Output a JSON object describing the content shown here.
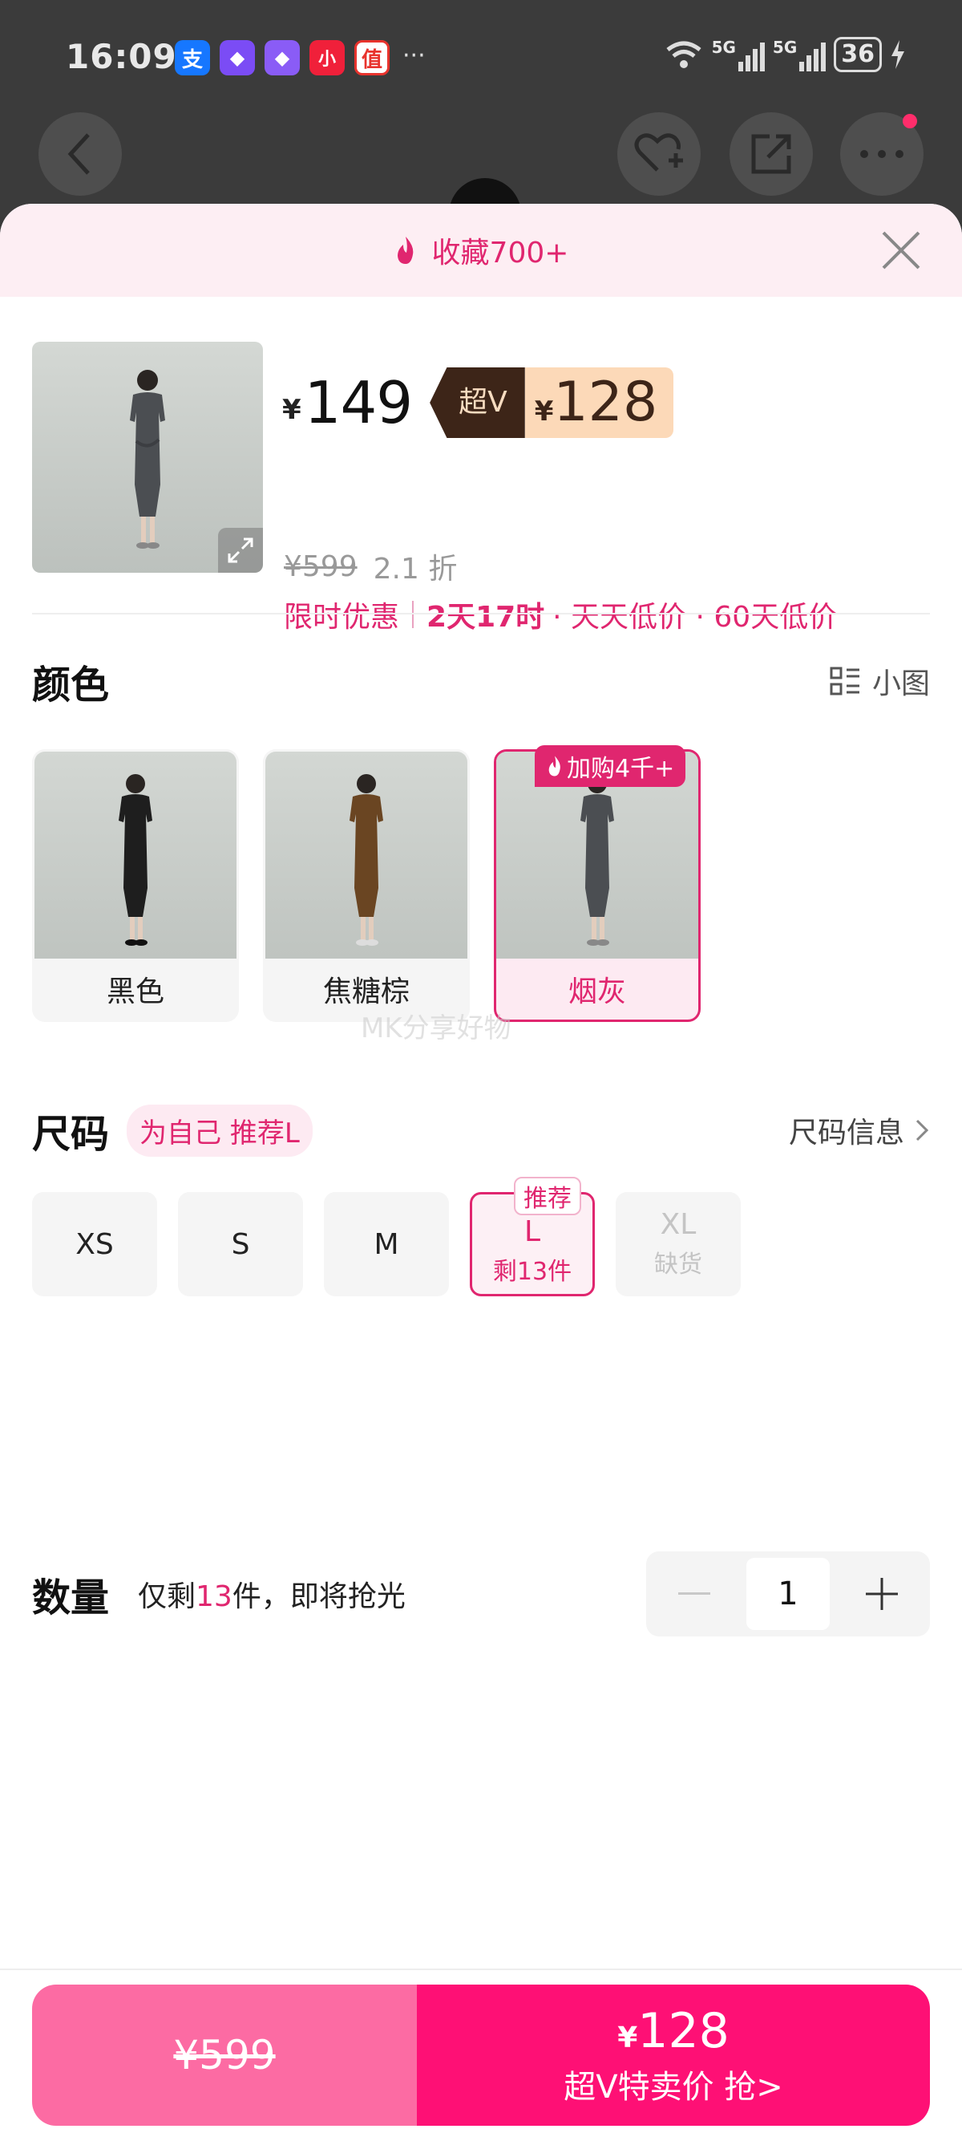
{
  "status_bar": {
    "time": "16:09",
    "apps": [
      {
        "glyph": "支",
        "color": "#1677ff",
        "name": "alipay-icon"
      },
      {
        "glyph": "◆",
        "color": "#7b4cf5",
        "name": "app-diamond-icon"
      },
      {
        "glyph": "◆",
        "color": "#8a5cf6",
        "name": "app-diamond-icon-2"
      },
      {
        "glyph": "小",
        "color": "#f0203a",
        "name": "xiaohongshu-icon"
      },
      {
        "glyph": "值",
        "color": "#e8332d",
        "name": "smzdm-icon"
      }
    ],
    "more": "···",
    "battery": "36",
    "net_1": "5G",
    "net_2": "5G"
  },
  "sheet": {
    "banner_text": "收藏700+",
    "product": {
      "currency": "¥",
      "price": "149",
      "vip_label": "超V",
      "vip_price": "128",
      "original_price": "¥599",
      "discount": "2.1 折",
      "promo_label": "限时优惠",
      "promo_time": "2天17时",
      "promo_tags": "· 天天低价 · 60天低价"
    },
    "color": {
      "title": "颜色",
      "view_toggle": "小图",
      "options": [
        {
          "label": "黑色",
          "dress": "#1e1e1e"
        },
        {
          "label": "焦糖棕",
          "dress": "#6a4522"
        },
        {
          "label": "烟灰",
          "dress": "#4b4e52",
          "badge": "加购4千+"
        }
      ]
    },
    "watermark": "MK分享好物",
    "size": {
      "title": "尺码",
      "recommend": "为自己 推荐L",
      "info_link": "尺码信息",
      "options": [
        {
          "label": "XS"
        },
        {
          "label": "S"
        },
        {
          "label": "M"
        },
        {
          "label": "L",
          "sub": "剩13件",
          "tag": "推荐"
        },
        {
          "label": "XL",
          "sub": "缺货"
        }
      ]
    },
    "quantity": {
      "title": "数量",
      "hint_prefix": "仅剩",
      "hint_count": "13",
      "hint_suffix": "件，即将抢光",
      "value": "1"
    }
  },
  "bottom_bar": {
    "normal_price": "¥599",
    "vip_currency": "¥",
    "vip_price": "128",
    "vip_label": "超V特卖价 抢>"
  },
  "colors": {
    "accent": "#e0266f",
    "buy_vip": "#fe1075",
    "buy_normal": "#fc6ba3",
    "vip_dark": "#3d2518",
    "vip_light": "#fcd9b8"
  }
}
